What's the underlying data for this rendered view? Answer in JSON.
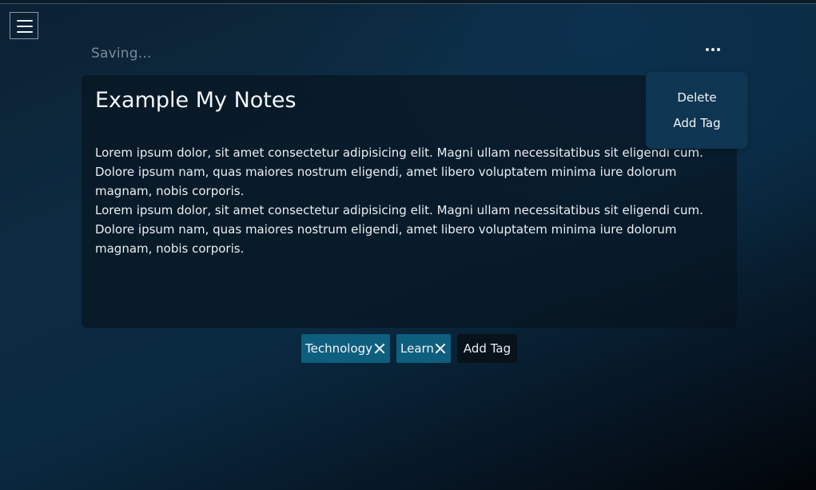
{
  "header": {
    "menu_icon": "hamburger-menu-icon",
    "status": "Saving...",
    "more_icon": "more-horizontal-icon"
  },
  "dropdown": {
    "items": [
      {
        "label": "Delete"
      },
      {
        "label": "Add Tag"
      }
    ]
  },
  "note": {
    "title": "Example My Notes",
    "paragraphs": [
      "Lorem ipsum dolor, sit amet consectetur adipisicing elit. Magni ullam necessitatibus sit eligendi cum. Dolore ipsum nam, quas maiores nostrum eligendi, amet libero voluptatem minima iure dolorum magnam, nobis corporis.",
      "Lorem ipsum dolor, sit amet consectetur adipisicing elit. Magni ullam necessitatibus sit eligendi cum. Dolore ipsum nam, quas maiores nostrum eligendi, amet libero voluptatem minima iure dolorum magnam, nobis corporis."
    ]
  },
  "tags": {
    "items": [
      {
        "label": "Technology",
        "remove_icon": "close-icon"
      },
      {
        "label": "Learn",
        "remove_icon": "close-icon"
      }
    ],
    "add_label": "Add Tag"
  },
  "colors": {
    "tag_background": "#0e5e7e",
    "dropdown_background": "#0e3552",
    "status_text": "#7c8995"
  }
}
